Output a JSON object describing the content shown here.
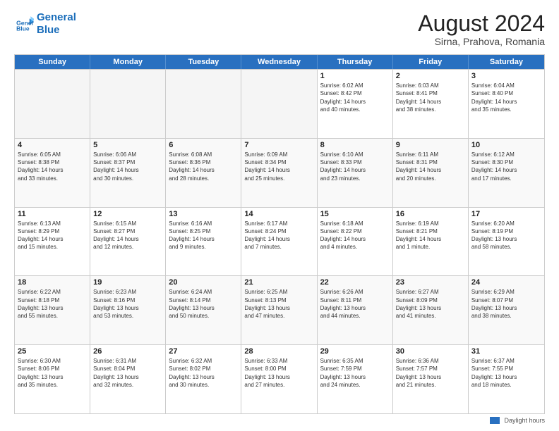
{
  "header": {
    "logo_line1": "General",
    "logo_line2": "Blue",
    "title": "August 2024",
    "subtitle": "Sirna, Prahova, Romania"
  },
  "days_of_week": [
    "Sunday",
    "Monday",
    "Tuesday",
    "Wednesday",
    "Thursday",
    "Friday",
    "Saturday"
  ],
  "legend": "Daylight hours",
  "weeks": [
    [
      {
        "day": "",
        "info": ""
      },
      {
        "day": "",
        "info": ""
      },
      {
        "day": "",
        "info": ""
      },
      {
        "day": "",
        "info": ""
      },
      {
        "day": "1",
        "info": "Sunrise: 6:02 AM\nSunset: 8:42 PM\nDaylight: 14 hours\nand 40 minutes."
      },
      {
        "day": "2",
        "info": "Sunrise: 6:03 AM\nSunset: 8:41 PM\nDaylight: 14 hours\nand 38 minutes."
      },
      {
        "day": "3",
        "info": "Sunrise: 6:04 AM\nSunset: 8:40 PM\nDaylight: 14 hours\nand 35 minutes."
      }
    ],
    [
      {
        "day": "4",
        "info": "Sunrise: 6:05 AM\nSunset: 8:38 PM\nDaylight: 14 hours\nand 33 minutes."
      },
      {
        "day": "5",
        "info": "Sunrise: 6:06 AM\nSunset: 8:37 PM\nDaylight: 14 hours\nand 30 minutes."
      },
      {
        "day": "6",
        "info": "Sunrise: 6:08 AM\nSunset: 8:36 PM\nDaylight: 14 hours\nand 28 minutes."
      },
      {
        "day": "7",
        "info": "Sunrise: 6:09 AM\nSunset: 8:34 PM\nDaylight: 14 hours\nand 25 minutes."
      },
      {
        "day": "8",
        "info": "Sunrise: 6:10 AM\nSunset: 8:33 PM\nDaylight: 14 hours\nand 23 minutes."
      },
      {
        "day": "9",
        "info": "Sunrise: 6:11 AM\nSunset: 8:31 PM\nDaylight: 14 hours\nand 20 minutes."
      },
      {
        "day": "10",
        "info": "Sunrise: 6:12 AM\nSunset: 8:30 PM\nDaylight: 14 hours\nand 17 minutes."
      }
    ],
    [
      {
        "day": "11",
        "info": "Sunrise: 6:13 AM\nSunset: 8:29 PM\nDaylight: 14 hours\nand 15 minutes."
      },
      {
        "day": "12",
        "info": "Sunrise: 6:15 AM\nSunset: 8:27 PM\nDaylight: 14 hours\nand 12 minutes."
      },
      {
        "day": "13",
        "info": "Sunrise: 6:16 AM\nSunset: 8:25 PM\nDaylight: 14 hours\nand 9 minutes."
      },
      {
        "day": "14",
        "info": "Sunrise: 6:17 AM\nSunset: 8:24 PM\nDaylight: 14 hours\nand 7 minutes."
      },
      {
        "day": "15",
        "info": "Sunrise: 6:18 AM\nSunset: 8:22 PM\nDaylight: 14 hours\nand 4 minutes."
      },
      {
        "day": "16",
        "info": "Sunrise: 6:19 AM\nSunset: 8:21 PM\nDaylight: 14 hours\nand 1 minute."
      },
      {
        "day": "17",
        "info": "Sunrise: 6:20 AM\nSunset: 8:19 PM\nDaylight: 13 hours\nand 58 minutes."
      }
    ],
    [
      {
        "day": "18",
        "info": "Sunrise: 6:22 AM\nSunset: 8:18 PM\nDaylight: 13 hours\nand 55 minutes."
      },
      {
        "day": "19",
        "info": "Sunrise: 6:23 AM\nSunset: 8:16 PM\nDaylight: 13 hours\nand 53 minutes."
      },
      {
        "day": "20",
        "info": "Sunrise: 6:24 AM\nSunset: 8:14 PM\nDaylight: 13 hours\nand 50 minutes."
      },
      {
        "day": "21",
        "info": "Sunrise: 6:25 AM\nSunset: 8:13 PM\nDaylight: 13 hours\nand 47 minutes."
      },
      {
        "day": "22",
        "info": "Sunrise: 6:26 AM\nSunset: 8:11 PM\nDaylight: 13 hours\nand 44 minutes."
      },
      {
        "day": "23",
        "info": "Sunrise: 6:27 AM\nSunset: 8:09 PM\nDaylight: 13 hours\nand 41 minutes."
      },
      {
        "day": "24",
        "info": "Sunrise: 6:29 AM\nSunset: 8:07 PM\nDaylight: 13 hours\nand 38 minutes."
      }
    ],
    [
      {
        "day": "25",
        "info": "Sunrise: 6:30 AM\nSunset: 8:06 PM\nDaylight: 13 hours\nand 35 minutes."
      },
      {
        "day": "26",
        "info": "Sunrise: 6:31 AM\nSunset: 8:04 PM\nDaylight: 13 hours\nand 32 minutes."
      },
      {
        "day": "27",
        "info": "Sunrise: 6:32 AM\nSunset: 8:02 PM\nDaylight: 13 hours\nand 30 minutes."
      },
      {
        "day": "28",
        "info": "Sunrise: 6:33 AM\nSunset: 8:00 PM\nDaylight: 13 hours\nand 27 minutes."
      },
      {
        "day": "29",
        "info": "Sunrise: 6:35 AM\nSunset: 7:59 PM\nDaylight: 13 hours\nand 24 minutes."
      },
      {
        "day": "30",
        "info": "Sunrise: 6:36 AM\nSunset: 7:57 PM\nDaylight: 13 hours\nand 21 minutes."
      },
      {
        "day": "31",
        "info": "Sunrise: 6:37 AM\nSunset: 7:55 PM\nDaylight: 13 hours\nand 18 minutes."
      }
    ]
  ]
}
